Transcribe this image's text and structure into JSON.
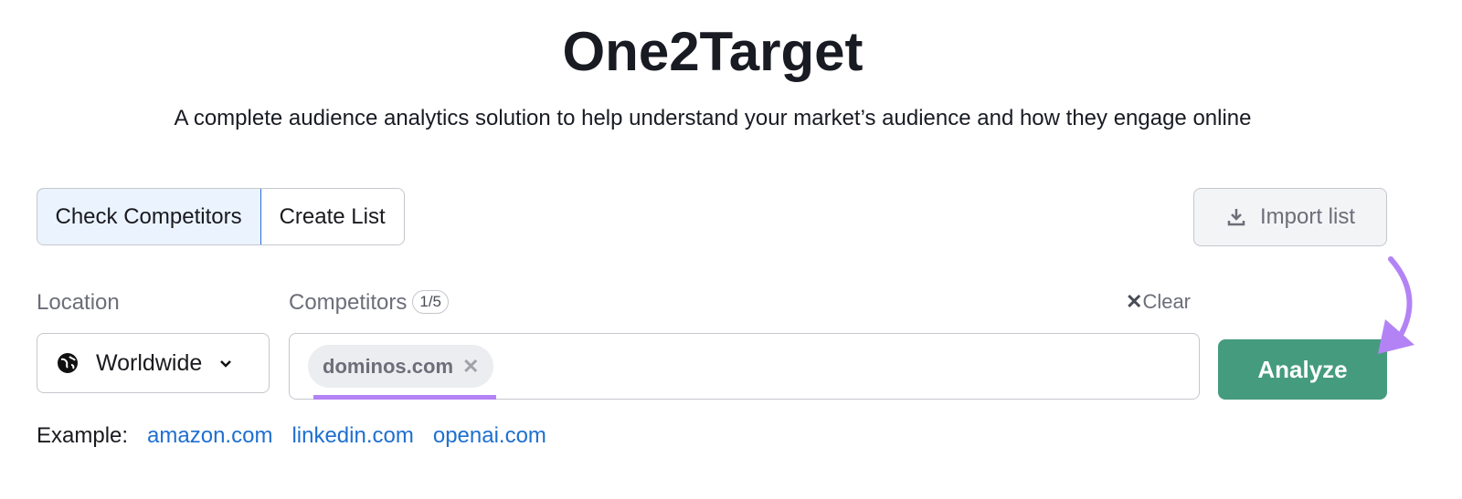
{
  "header": {
    "title": "One2Target",
    "subtitle": "A complete audience analytics solution to help understand your market’s audience and how they engage online"
  },
  "tabs": [
    {
      "label": "Check Competitors",
      "active": true
    },
    {
      "label": "Create List",
      "active": false
    }
  ],
  "import_label": "Import list",
  "location": {
    "label": "Location",
    "value": "Worldwide",
    "icon": "globe-icon"
  },
  "competitors": {
    "label": "Competitors",
    "count": "1/5",
    "clear_label": "Clear",
    "chips": [
      "dominos.com"
    ]
  },
  "analyze_label": "Analyze",
  "examples": {
    "label": "Example:",
    "links": [
      "amazon.com",
      "linkedin.com",
      "openai.com"
    ]
  },
  "colors": {
    "accent": "#449b7e",
    "annotation": "#b383f5",
    "link": "#1e6fd0"
  }
}
